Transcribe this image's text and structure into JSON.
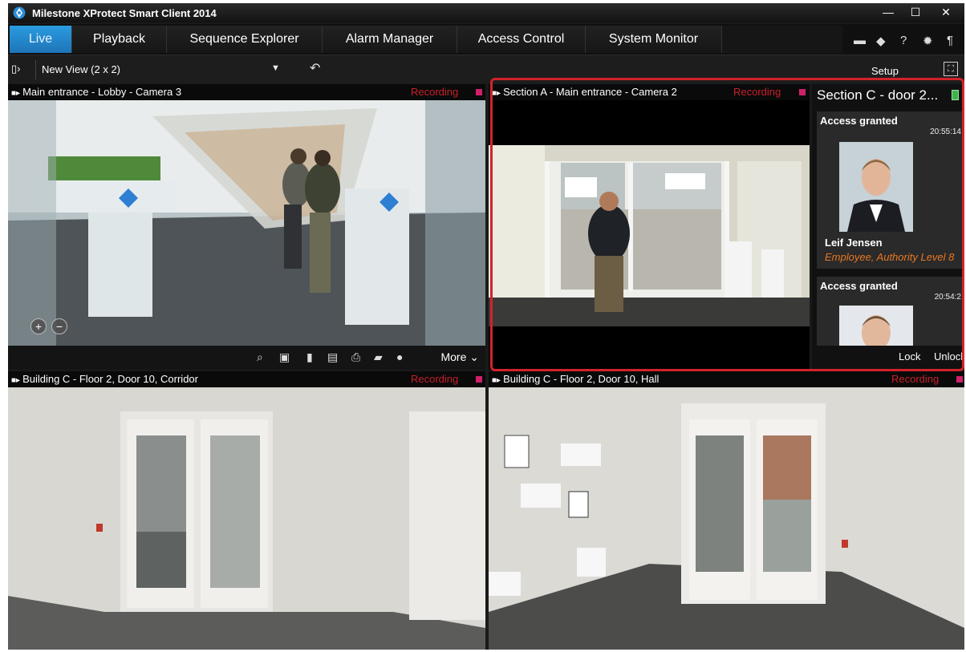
{
  "app": {
    "title": "Milestone XProtect Smart Client 2014"
  },
  "window_controls": {
    "minimize": "—",
    "maximize": "☐",
    "close": "✕"
  },
  "tabs": [
    {
      "label": "Live",
      "active": true
    },
    {
      "label": "Playback"
    },
    {
      "label": "Sequence Explorer"
    },
    {
      "label": "Alarm Manager"
    },
    {
      "label": "Access Control"
    },
    {
      "label": "System Monitor"
    }
  ],
  "toolbar_icons": [
    "monitor-icon",
    "eye-icon",
    "help-icon",
    "gear-icon",
    "info-icon"
  ],
  "view": {
    "name": "New View (2 x 2)",
    "setup_label": "Setup"
  },
  "cameras": [
    {
      "name": "Main entrance - Lobby - Camera 3",
      "status": "Recording",
      "toolbar": {
        "more_label": "More"
      }
    },
    {
      "name": "Section A - Main entrance - Camera 2",
      "status": "Recording"
    },
    {
      "name": "Building C - Floor 2, Door 10, Corridor",
      "status": "Recording"
    },
    {
      "name": "Building C - Floor 2, Door 10, Hall",
      "status": "Recording"
    }
  ],
  "access_panel": {
    "title": "Section C - door 2...",
    "events": [
      {
        "label": "Access granted",
        "time": "20:55:14",
        "name": "Leif Jensen",
        "role": "Employee, Authority Level 8"
      },
      {
        "label": "Access granted",
        "time": "20:54:2"
      }
    ],
    "lock_label": "Lock",
    "unlock_label": "Unlock"
  },
  "colors": {
    "accent": "#1f8bd6",
    "recording": "#c8202a",
    "highlight": "#d2232a",
    "role_text": "#e87722"
  }
}
